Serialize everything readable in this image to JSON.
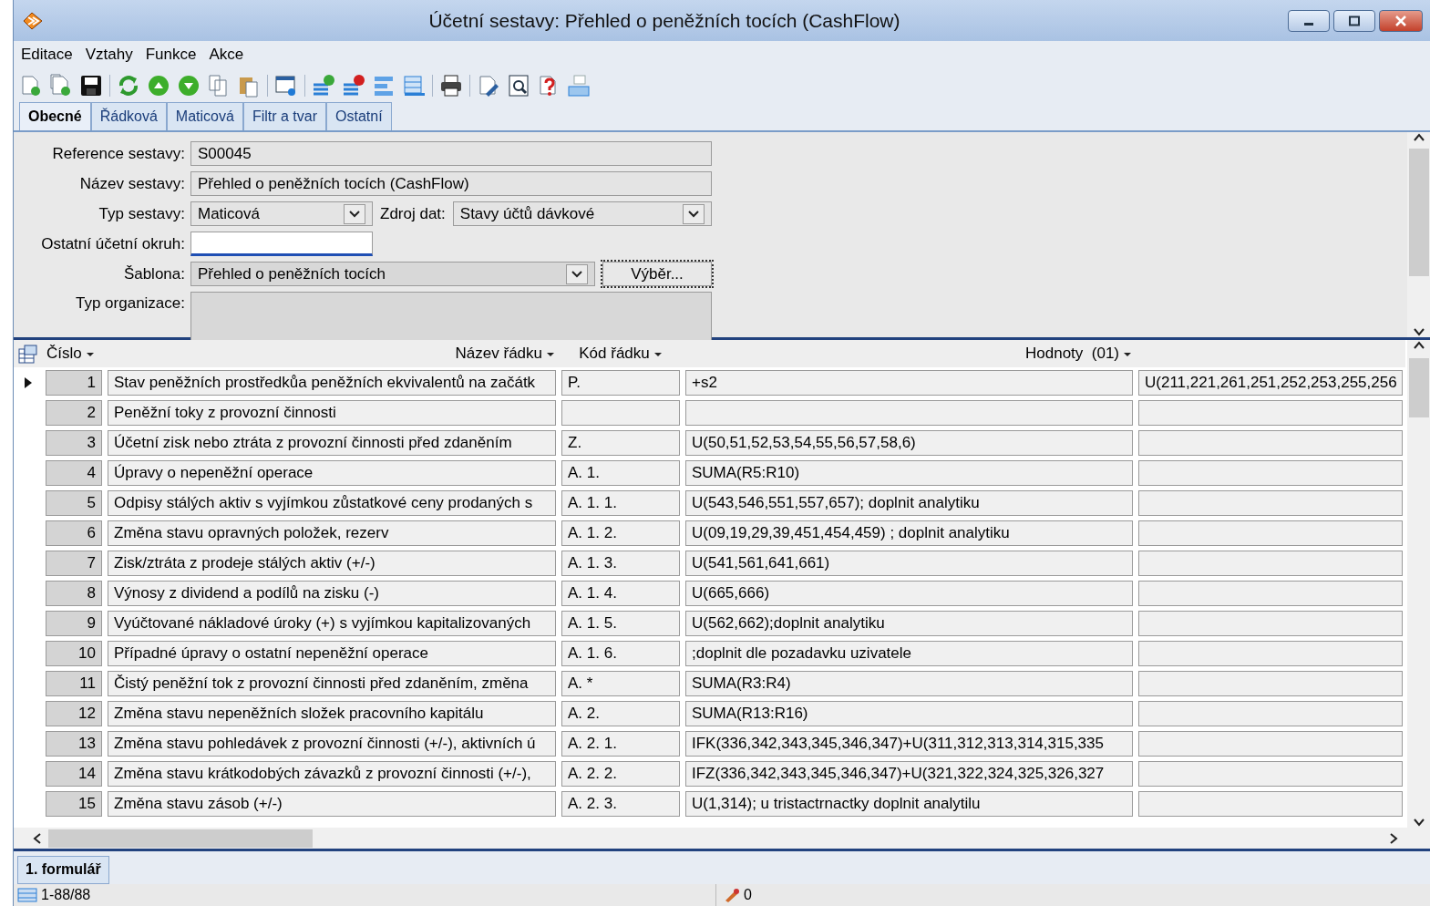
{
  "window": {
    "title": "Účetní sestavy: Přehled o peněžních tocích (CashFlow)"
  },
  "menu": [
    "Editace",
    "Vztahy",
    "Funkce",
    "Akce"
  ],
  "tabs": [
    {
      "label": "Obecné",
      "selected": true
    },
    {
      "label": "Řádková",
      "selected": false
    },
    {
      "label": "Maticová",
      "selected": false
    },
    {
      "label": "Filtr a tvar",
      "selected": false
    },
    {
      "label": "Ostatní",
      "selected": false
    }
  ],
  "form": {
    "reference": {
      "label": "Reference sestavy:",
      "value": "S00045"
    },
    "name": {
      "label": "Název sestavy:",
      "value": "Přehled o peněžních tocích (CashFlow)"
    },
    "type": {
      "label": "Typ sestavy:",
      "value": "Maticová"
    },
    "source": {
      "label": "Zdroj dat:",
      "value": "Stavy účtů dávkové"
    },
    "other_circuit": {
      "label": "Ostatní účetní okruh:",
      "focused": true
    },
    "template": {
      "label": "Šablona:",
      "value": "Přehled o peněžních tocích",
      "button": "Výběr..."
    },
    "organization_type": {
      "label": "Typ organizace:"
    }
  },
  "table": {
    "columns": [
      "Číslo",
      "Název řádku",
      "Kód řádku",
      "Hodnoty  (01)"
    ],
    "rows": [
      {
        "current": true,
        "cells": [
          "1",
          "Stav peněžních prostředkůa peněžních ekvivalentů na začátk",
          "P.",
          "+s2",
          "U(211,221,261,251,252,253,255,256"
        ]
      },
      {
        "current": false,
        "cells": [
          "2",
          "Peněžní toky z provozní činnosti",
          "",
          "",
          ""
        ]
      },
      {
        "current": false,
        "cells": [
          "3",
          "Účetní zisk nebo ztráta z provozní činnosti před zdaněním",
          "Z.",
          "U(50,51,52,53,54,55,56,57,58,6)",
          ""
        ]
      },
      {
        "current": false,
        "cells": [
          "4",
          "Úpravy o nepeněžní operace",
          "A. 1.",
          "SUMA(R5:R10)",
          ""
        ]
      },
      {
        "current": false,
        "cells": [
          "5",
          "Odpisy stálých aktiv s vyjímkou zůstatkové ceny prodaných s",
          "A. 1. 1.",
          "U(543,546,551,557,657); doplnit analytiku",
          ""
        ]
      },
      {
        "current": false,
        "cells": [
          "6",
          "Změna stavu opravných položek, rezerv",
          "A. 1. 2.",
          "U(09,19,29,39,451,454,459) ; doplnit analytiku",
          ""
        ]
      },
      {
        "current": false,
        "cells": [
          "7",
          "Zisk/ztráta z prodeje stálých aktiv (+/-)",
          "A. 1. 3.",
          "U(541,561,641,661)",
          ""
        ]
      },
      {
        "current": false,
        "cells": [
          "8",
          "Výnosy z dividend a podílů na zisku (-)",
          "A. 1. 4.",
          "U(665,666)",
          ""
        ]
      },
      {
        "current": false,
        "cells": [
          "9",
          "Vyúčtované nákladové úroky (+) s vyjímkou kapitalizovaných",
          "A. 1. 5.",
          "U(562,662);doplnit analytiku",
          ""
        ]
      },
      {
        "current": false,
        "cells": [
          "10",
          "Případné úpravy o ostatní nepeněžní operace",
          "A. 1. 6.",
          ";doplnit dle pozadavku uzivatele",
          ""
        ]
      },
      {
        "current": false,
        "cells": [
          "11",
          "Čistý peněžní tok z provozní činnosti před zdaněním, změna",
          "A. *",
          "SUMA(R3:R4)",
          ""
        ]
      },
      {
        "current": false,
        "cells": [
          "12",
          "Změna stavu nepeněžních složek pracovního kapitálu",
          "A. 2.",
          "SUMA(R13:R16)",
          ""
        ]
      },
      {
        "current": false,
        "cells": [
          "13",
          "Změna stavu pohledávek z provozní činnosti (+/-), aktivních ú",
          "A. 2. 1.",
          "IFK(336,342,343,345,346,347)+U(311,312,313,314,315,335",
          ""
        ]
      },
      {
        "current": false,
        "cells": [
          "14",
          "Změna stavu krátkodobých závazků z provozní činnosti (+/-),",
          "A. 2. 2.",
          "IFZ(336,342,343,345,346,347)+U(321,322,324,325,326,327",
          ""
        ]
      },
      {
        "current": false,
        "cells": [
          "15",
          "Změna stavu zásob (+/-)",
          "A. 2. 3.",
          "U(1,314); u tristactrnactky doplnit analytilu",
          ""
        ]
      }
    ]
  },
  "bottom_tabs": [
    {
      "label": "1. formulář",
      "selected": true
    }
  ],
  "status_bar": {
    "records": "1-88/88",
    "count": "0"
  }
}
